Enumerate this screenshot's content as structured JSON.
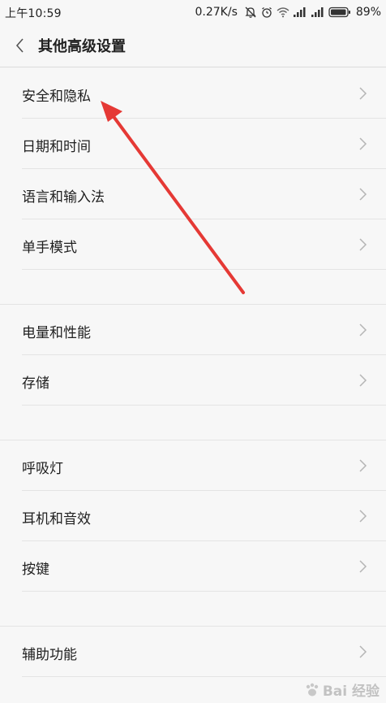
{
  "status_bar": {
    "time": "上午10:59",
    "net_speed": "0.27K/s",
    "battery_percent": "89%",
    "icons": [
      "alarm-off-icon",
      "alarm-clock-icon",
      "wifi-icon",
      "signal-icon",
      "signal-icon",
      "battery-icon"
    ]
  },
  "header": {
    "back_icon": "chevron-left-icon",
    "title": "其他高级设置"
  },
  "groups": [
    [
      {
        "label": "安全和隐私"
      },
      {
        "label": "日期和时间"
      },
      {
        "label": "语言和输入法"
      },
      {
        "label": "单手模式"
      }
    ],
    [
      {
        "label": "电量和性能"
      },
      {
        "label": "存储"
      }
    ],
    [
      {
        "label": "呼吸灯"
      },
      {
        "label": "耳机和音效"
      },
      {
        "label": "按键"
      }
    ],
    [
      {
        "label": "辅助功能"
      }
    ]
  ],
  "annotation": {
    "arrow_color": "#e53935"
  },
  "watermark": {
    "text": "Bai 经验"
  }
}
